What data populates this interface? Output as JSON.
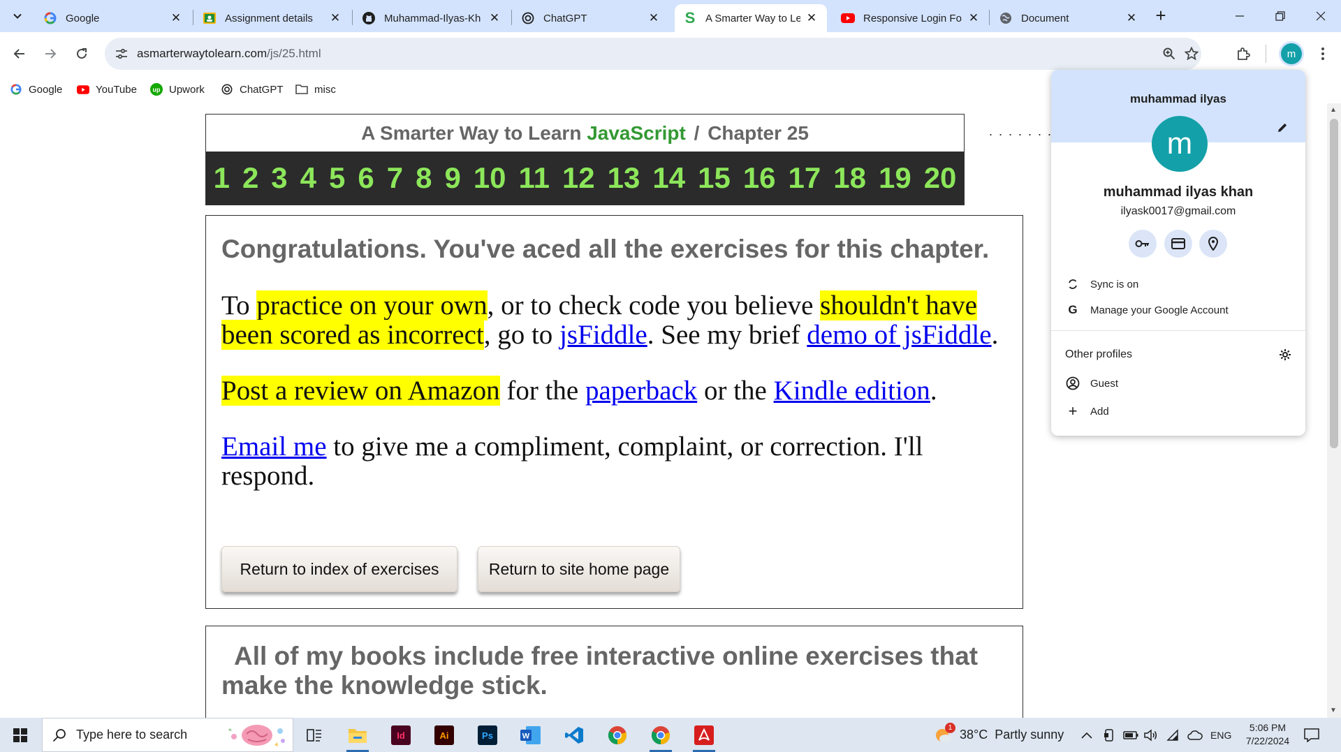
{
  "browser": {
    "tabs": [
      {
        "title": "Google",
        "icon": "google-icon"
      },
      {
        "title": "Assignment details",
        "icon": "classroom-icon"
      },
      {
        "title": "Muhammad-Ilyas-Kh",
        "icon": "github-icon"
      },
      {
        "title": "ChatGPT",
        "icon": "chatgpt-icon"
      },
      {
        "title": "A Smarter Way to Le",
        "icon": "smarter-way-icon",
        "active": true
      },
      {
        "title": "Responsive Login Fo",
        "icon": "youtube-icon"
      },
      {
        "title": "Document",
        "icon": "globe-icon"
      }
    ],
    "url_domain": "asmarterwaytolearn.com",
    "url_path": "/js/25.html",
    "bookmarks": [
      {
        "label": "Google",
        "icon": "google-icon"
      },
      {
        "label": "YouTube",
        "icon": "youtube-icon"
      },
      {
        "label": "Upwork",
        "icon": "upwork-icon"
      },
      {
        "label": "ChatGPT",
        "icon": "chatgpt-icon"
      },
      {
        "label": "misc",
        "icon": "folder-icon"
      }
    ],
    "avatar_letter": "m"
  },
  "page": {
    "site_title_prefix": "A Smarter Way to Learn",
    "site_title_js": "JavaScript",
    "site_title_sep": "/",
    "site_title_chapter": "Chapter 25",
    "chapters": [
      "1",
      "2",
      "3",
      "4",
      "5",
      "6",
      "7",
      "8",
      "9",
      "10",
      "11",
      "12",
      "13",
      "14",
      "15",
      "16",
      "17",
      "18",
      "19",
      "20"
    ],
    "dots": ". . . . . . . . .",
    "congrats": "Congratulations. You've aced all the exercises for this chapter.",
    "p1": {
      "t1": "To ",
      "h1": "practice on your own",
      "t2": ", or to check code you believe ",
      "h2": "shouldn't have been scored as incorrect",
      "t3": ", go to ",
      "l1": "jsFiddle",
      "t4": ". See my brief ",
      "l2": "demo of jsFiddle",
      "t5": "."
    },
    "p2": {
      "h1": "Post a review on Amazon",
      "t1": " for the ",
      "l1": "paperback",
      "t2": " or the ",
      "l2": "Kindle edition",
      "t3": "."
    },
    "p3": {
      "l1": "Email me",
      "t1": " to give me a compliment, complaint, or correction. I'll respond."
    },
    "btn_index": "Return to index of exercises",
    "btn_home": "Return to site home page",
    "books": "All of my books include free interactive online exercises that make the knowledge stick."
  },
  "profile_menu": {
    "header_name": "muhammad ilyas",
    "avatar_letter": "m",
    "full_name": "muhammad ilyas khan",
    "email": "ilyask0017@gmail.com",
    "sync": "Sync is on",
    "manage": "Manage your Google Account",
    "other_profiles": "Other profiles",
    "guest": "Guest",
    "add": "Add"
  },
  "taskbar": {
    "search_placeholder": "Type here to search",
    "weather": "38°C  Partly sunny",
    "weather_badge": "1",
    "language": "ENG",
    "time": "5:06 PM",
    "date": "7/22/2024"
  },
  "colors": {
    "tab_strip": "#d3e3fd",
    "chapter_bar": "#2b2b2b",
    "chapter_numbers": "#8ce65a",
    "javascript_word": "#339933",
    "highlight": "#ffff00",
    "link": "#0000ee",
    "avatar": "#13a0a8"
  }
}
